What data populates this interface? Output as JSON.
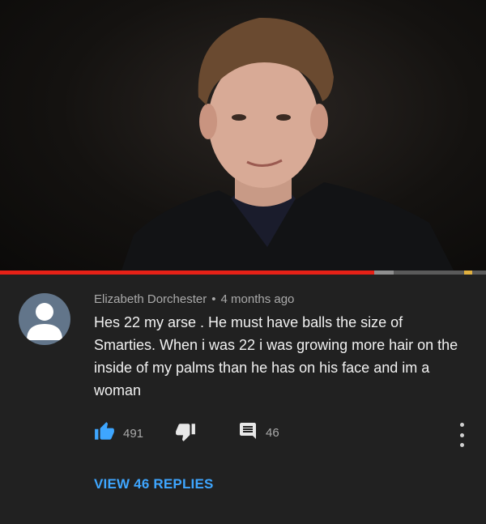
{
  "video": {
    "progress_fraction": 0.77,
    "buffered_fraction": 0.81,
    "colors": {
      "played": "#e62117",
      "buffered": "#8f8f8f",
      "track": "#5a5a5a"
    }
  },
  "comment": {
    "author": "Elizabeth Dorchester",
    "separator": "•",
    "timestamp": "4 months ago",
    "text": "Hes 22 my arse . He must have balls the size of Smarties.  When i was 22 i was growing more hair on the inside of my palms than he has on his face and im a woman",
    "likes": "491",
    "replies_count": "46",
    "view_replies_label": "VIEW 46 REPLIES",
    "icons": {
      "like": "thumbs-up-icon",
      "dislike": "thumbs-down-icon",
      "reply": "comment-icon",
      "menu": "more-vertical-icon",
      "avatar": "default-avatar-icon"
    },
    "colors": {
      "like_active": "#3ea6ff",
      "link": "#3ea6ff"
    }
  }
}
